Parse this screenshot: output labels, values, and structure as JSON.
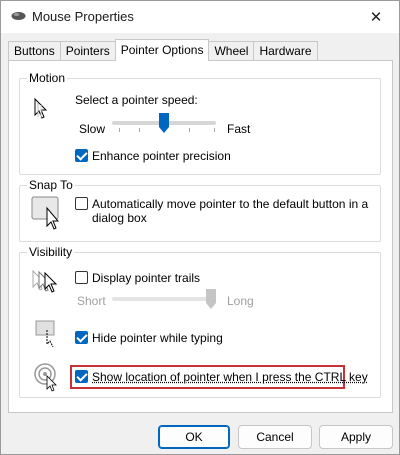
{
  "window": {
    "title": "Mouse Properties",
    "close_symbol": "✕"
  },
  "tabs": [
    {
      "label": "Buttons"
    },
    {
      "label": "Pointers"
    },
    {
      "label": "Pointer Options",
      "active": true
    },
    {
      "label": "Wheel"
    },
    {
      "label": "Hardware"
    }
  ],
  "motion": {
    "title": "Motion",
    "speed_label": "Select a pointer speed:",
    "slow_label": "Slow",
    "fast_label": "Fast",
    "speed_value": 0.5,
    "enhance_precision": {
      "label": "Enhance pointer precision",
      "checked": true
    }
  },
  "snap_to": {
    "title": "Snap To",
    "auto_move": {
      "label_line1": "Automatically move pointer to the default button in a",
      "label_line2": "dialog box",
      "checked": false
    }
  },
  "visibility": {
    "title": "Visibility",
    "trails": {
      "label": "Display pointer trails",
      "checked": false
    },
    "short_label": "Short",
    "long_label": "Long",
    "trail_length": 1.0,
    "hide_typing": {
      "label": "Hide pointer while typing",
      "checked": true
    },
    "show_location": {
      "label": "Show location of pointer when I press the CTRL key",
      "checked": true
    }
  },
  "buttons": {
    "ok": "OK",
    "cancel": "Cancel",
    "apply": "Apply"
  },
  "colors": {
    "accent": "#0067c0",
    "highlight": "#c8313a"
  }
}
